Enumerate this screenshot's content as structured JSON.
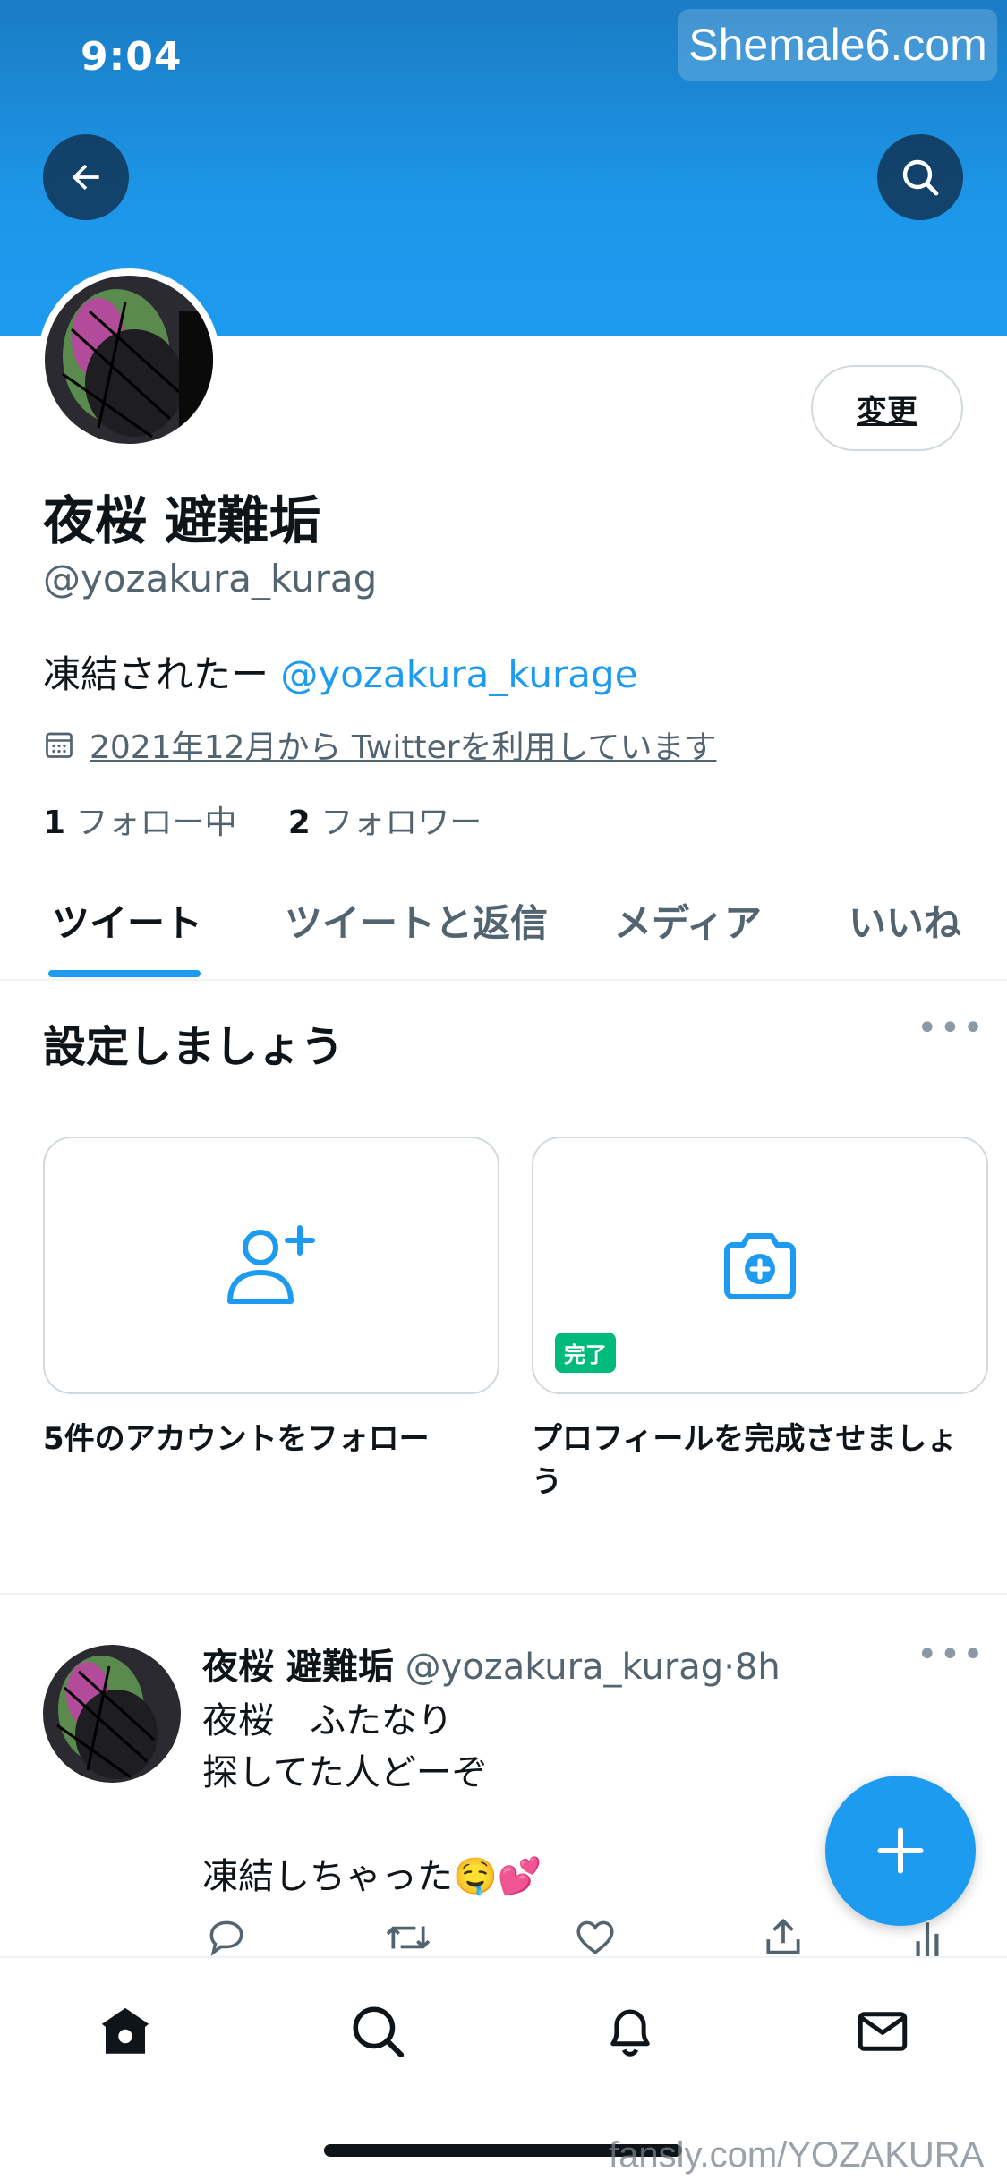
{
  "status_bar": {
    "time": "9:04"
  },
  "watermarks": {
    "top": "Shemale6.com",
    "bottom": "fansly.com/YOZAKURA"
  },
  "header": {
    "back_icon": "arrow-left-icon",
    "search_icon": "search-icon"
  },
  "profile": {
    "edit_button": "変更",
    "display_name": "夜桜 避難垢",
    "handle": "@yozakura_kurag",
    "bio_text": "凍結されたー ",
    "bio_mention": "@yozakura_kurage",
    "joined": "2021年12月から Twitterを利用しています",
    "following_count": "1",
    "following_label": " フォロー中",
    "followers_count": "2",
    "followers_label": " フォロワー"
  },
  "tabs": [
    {
      "label": "ツイート",
      "active": true
    },
    {
      "label": "ツイートと返信",
      "active": false
    },
    {
      "label": "メディア",
      "active": false
    },
    {
      "label": "いいね",
      "active": false
    }
  ],
  "setup": {
    "title": "設定しましょう",
    "cards": [
      {
        "label": "5件のアカウントをフォロー",
        "icon": "add-user-icon"
      },
      {
        "label": "プロフィールを完成させましょう",
        "icon": "camera-plus-icon",
        "badge": "完了"
      }
    ]
  },
  "tweet": {
    "name": "夜桜 避難垢",
    "handle": "@yozakura_kurag",
    "separator": "·",
    "time": "8h",
    "lines": [
      "夜桜　ふたなり",
      "探してた人どーぞ",
      "",
      "凍結しちゃった🤤💕"
    ]
  },
  "colors": {
    "accent": "#1d9bf0",
    "badge": "#00ba7c",
    "text": "#0f1419",
    "secondary": "#536471"
  },
  "bottom_nav": [
    "home-icon",
    "search-icon",
    "bell-icon",
    "mail-icon"
  ]
}
